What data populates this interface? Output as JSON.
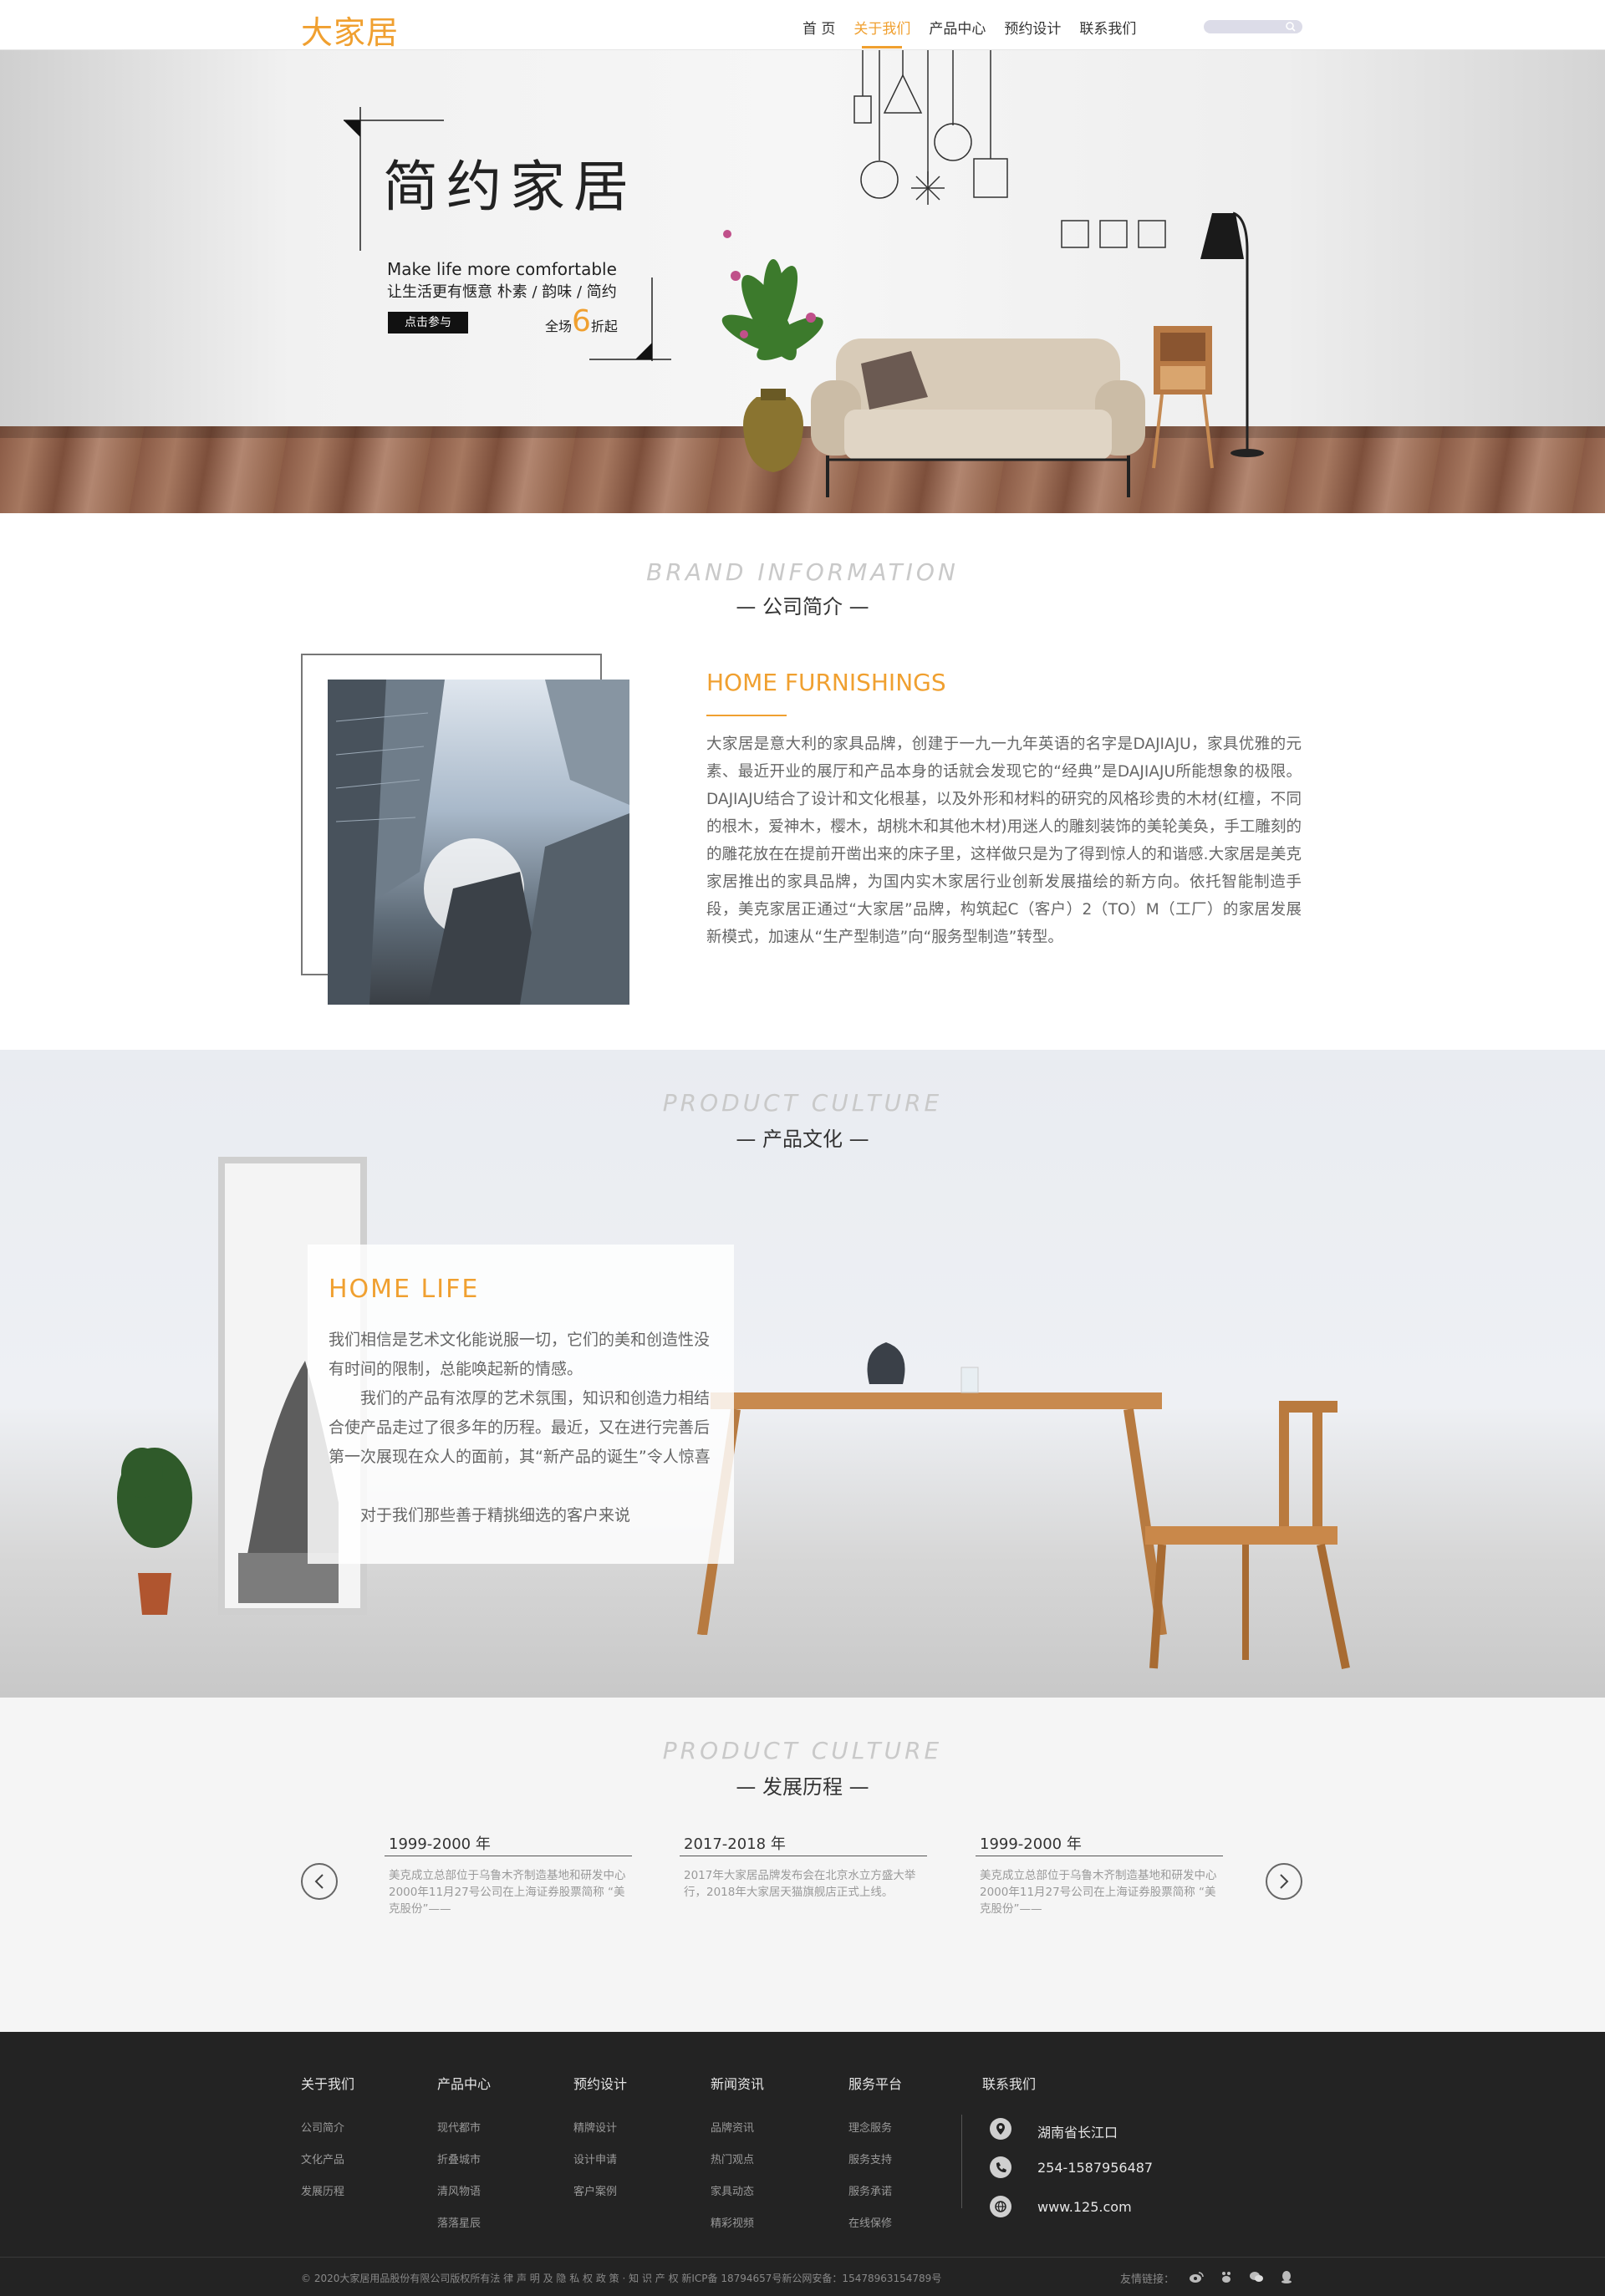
{
  "header": {
    "logo": "大家居",
    "nav": [
      "首 页",
      "关于我们",
      "产品中心",
      "预约设计",
      "联系我们"
    ],
    "active_index": 1,
    "search_placeholder": ""
  },
  "hero": {
    "title": "简约家居",
    "subtitle_en": "Make life more comfortable",
    "subtitle_cn": "让生活更有惬意 朴素 / 韵味 / 简约",
    "button": "点击参与",
    "discount_prefix": "全场",
    "discount_number": "6",
    "discount_suffix": "折起"
  },
  "brand": {
    "en": "BRAND INFORMATION",
    "cn": "— 公司简介 —",
    "heading": "HOME FURNISHINGS",
    "text": "大家居是意大利的家具品牌，创建于一九一九年英语的名字是DAJIAJU，家具优雅的元素、最近开业的展厅和产品本身的话就会发现它的“经典”是DAJIAJU所能想象的极限。DAJIAJU结合了设计和文化根基，以及外形和材料的研究的风格珍贵的木材(红檀，不同的根木，爱神木，樱木，胡桃木和其他木材)用迷人的雕刻装饰的美轮美奂，手工雕刻的的雕花放在在提前开凿出来的床子里，这样做只是为了得到惊人的和谐感.大家居是美克家居推出的家具品牌，为国内实木家居行业创新发展描绘的新方向。依托智能制造手段，美克家居正通过“大家居”品牌，构筑起C（客户）2（TO）M（工厂）的家居发展新模式，加速从“生产型制造”向“服务型制造”转型。"
  },
  "culture": {
    "en": "PRODUCT CULTURE",
    "cn": "— 产品文化 —",
    "heading": "HOME LIFE",
    "p1": "我们相信是艺术文化能说服一切，它们的美和创造性没有时间的限制，总能唤起新的情感。",
    "p2": "我们的产品有浓厚的艺术氛围，知识和创造力相结合使产品走过了很多年的历程。最近，又在进行完善后第一次展现在众人的面前，其“新产品的诞生”令人惊喜",
    "p3": "对于我们那些善于精挑细选的客户来说"
  },
  "history": {
    "en": "PRODUCT CULTURE",
    "cn": "— 发展历程 —",
    "items": [
      {
        "year": "1999-2000 年",
        "text": "美克成立总部位于乌鲁木齐制造基地和研发中心 2000年11月27号公司在上海证券股票简称 “美克股份”——"
      },
      {
        "year": "2017-2018 年",
        "text": "2017年大家居品牌发布会在北京水立方盛大举行，2018年大家居天猫旗舰店正式上线。"
      },
      {
        "year": "1999-2000 年",
        "text": "美克成立总部位于乌鲁木齐制造基地和研发中心 2000年11月27号公司在上海证券股票简称 “美克股份”——"
      }
    ]
  },
  "footer": {
    "columns": [
      {
        "title": "关于我们",
        "links": [
          "公司简介",
          "文化产品",
          "发展历程"
        ]
      },
      {
        "title": "产品中心",
        "links": [
          "现代都市",
          "折叠城市",
          "清风物语",
          "落落星辰"
        ]
      },
      {
        "title": "预约设计",
        "links": [
          "精牌设计",
          "设计申请",
          "客户案例"
        ]
      },
      {
        "title": "新闻资讯",
        "links": [
          "品牌资讯",
          "热门观点",
          "家具动态",
          "精彩视频"
        ]
      },
      {
        "title": "服务平台",
        "links": [
          "理念服务",
          "服务支持",
          "服务承诺",
          "在线保修"
        ]
      }
    ],
    "contact_title": "联系我们",
    "address": "湖南省长江口",
    "phone": "254-1587956487",
    "website": "www.125.com",
    "copyright": "© 2020大家居用品股份有限公司版权所有法 律 声 明 及 隐 私 权 政 策 · 知 识 产 权 新ICP备 18794657号新公网安备：15478963154789号",
    "friend_links": "友情链接："
  },
  "colors": {
    "accent": "#f0a030",
    "footer_bg": "#232323",
    "text": "#666666"
  }
}
